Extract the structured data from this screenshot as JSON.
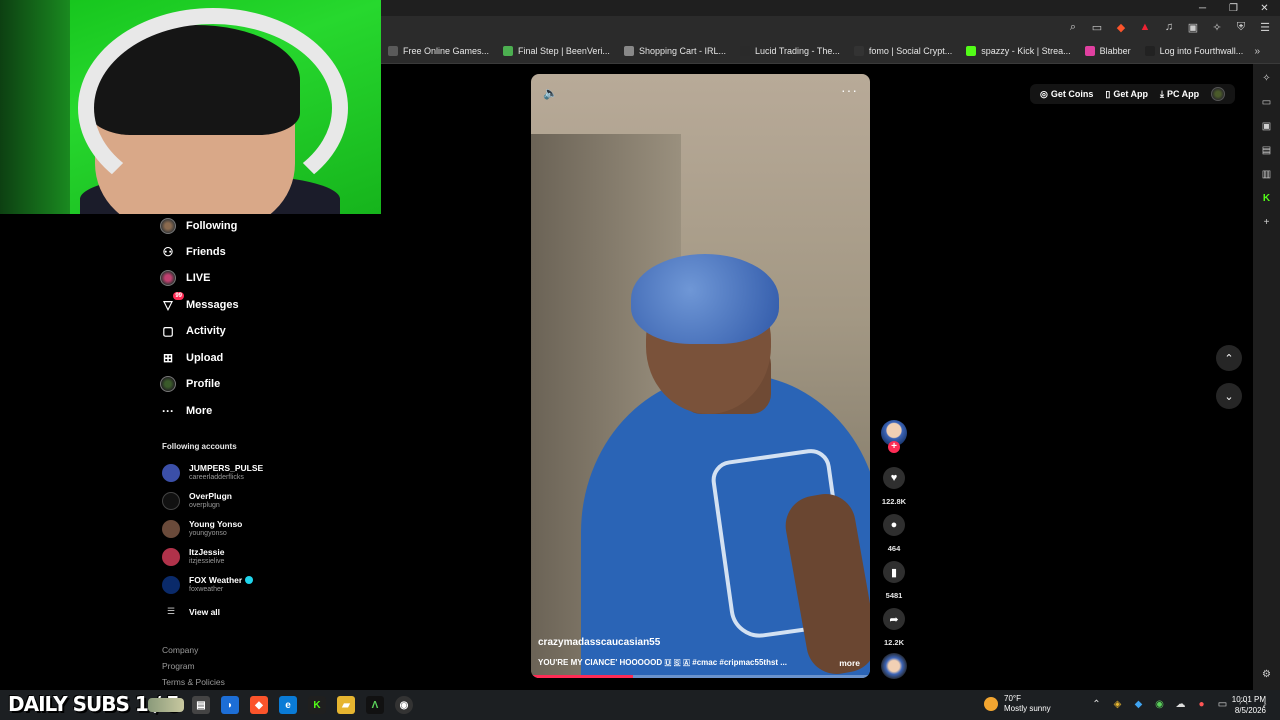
{
  "browser": {
    "bookmarks": [
      {
        "label": "Free Online Games...",
        "color": "#5a5a5a"
      },
      {
        "label": "Final Step | BeenVeri...",
        "color": "#4caf50"
      },
      {
        "label": "Shopping Cart - IRL...",
        "color": "#888888"
      },
      {
        "label": "Lucid Trading - The...",
        "color": "#2a2a2a"
      },
      {
        "label": "fomo | Social Crypt...",
        "color": "#333333"
      },
      {
        "label": "spazzy - Kick | Strea...",
        "color": "#53fc18"
      },
      {
        "label": "Blabber",
        "color": "#e040a0"
      },
      {
        "label": "Log into Fourthwall...",
        "color": "#222222"
      }
    ]
  },
  "sidebar": {
    "nav": [
      {
        "label": "Following",
        "icon": "following-avatar"
      },
      {
        "label": "Friends",
        "icon": "friends-icon"
      },
      {
        "label": "LIVE",
        "icon": "live-icon"
      },
      {
        "label": "Messages",
        "icon": "messages-icon",
        "badge": "99"
      },
      {
        "label": "Activity",
        "icon": "activity-icon"
      },
      {
        "label": "Upload",
        "icon": "upload-icon"
      },
      {
        "label": "Profile",
        "icon": "profile-avatar"
      },
      {
        "label": "More",
        "icon": "more-icon"
      }
    ],
    "following_title": "Following accounts",
    "accounts": [
      {
        "name": "JUMPERS_PULSE",
        "handle": "careerladderflicks",
        "color": "#3b4fa8"
      },
      {
        "name": "OverPlugn",
        "handle": "overplugn",
        "color": "#111111"
      },
      {
        "name": "Young Yonso",
        "handle": "youngyonso",
        "color": "#6a4a3a"
      },
      {
        "name": "ItzJessie",
        "handle": "itzjessielive",
        "color": "#b0324a"
      },
      {
        "name": "FOX Weather",
        "handle": "foxweather",
        "color": "#0a2a6a",
        "verified": true
      }
    ],
    "view_all": "View all",
    "footer": [
      "Company",
      "Program",
      "Terms & Policies"
    ]
  },
  "video": {
    "author": "crazymadasscaucasian55",
    "caption": "YOU'RE MY CIANCE' HOOOOOD 🇺 🇸 🇦 #cmac #cripmac55thst ...",
    "more": "more",
    "progress": 0.3,
    "likes": "122.8K",
    "comments": "464",
    "saves": "5481",
    "shares": "12.2K"
  },
  "top_actions": {
    "get_coins": "Get Coins",
    "get_app": "Get App",
    "pc_app": "PC App"
  },
  "taskbar": {
    "subs": "DAILY SUBS 1 / 5",
    "weather_temp": "70°F",
    "weather_desc": "Mostly sunny",
    "weather_alert": "1",
    "time": "10:01 PM",
    "date": "8/5/2026"
  }
}
